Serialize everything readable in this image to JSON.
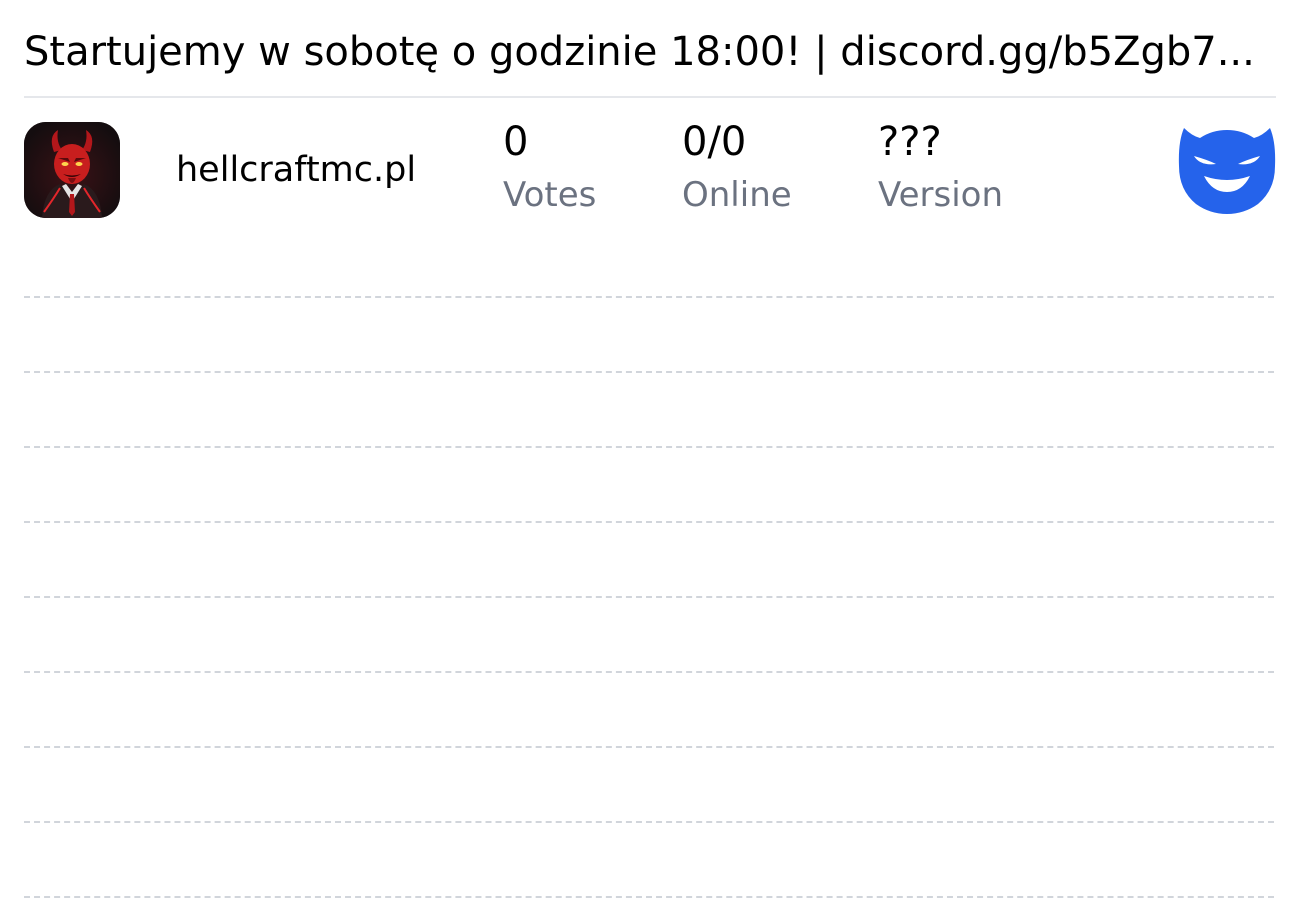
{
  "server": {
    "motd": "Startujemy w sobotę o godzinie 18:00! | discord.gg/b5Zgb7...",
    "name": "hellcraftmc.pl",
    "icon": "devil-avatar-icon",
    "stats": {
      "votes": {
        "value": "0",
        "label": "Votes"
      },
      "online": {
        "value": "0/0",
        "label": "Online"
      },
      "version": {
        "value": "???",
        "label": "Version"
      }
    },
    "badge_icon": "blue-devil-face-icon"
  },
  "colors": {
    "text": "#000000",
    "muted": "#6b7280",
    "divider": "#e5e7eb",
    "dashed_line": "#d1d5db",
    "badge_blue": "#2563eb",
    "icon_red": "#c81e1e"
  }
}
